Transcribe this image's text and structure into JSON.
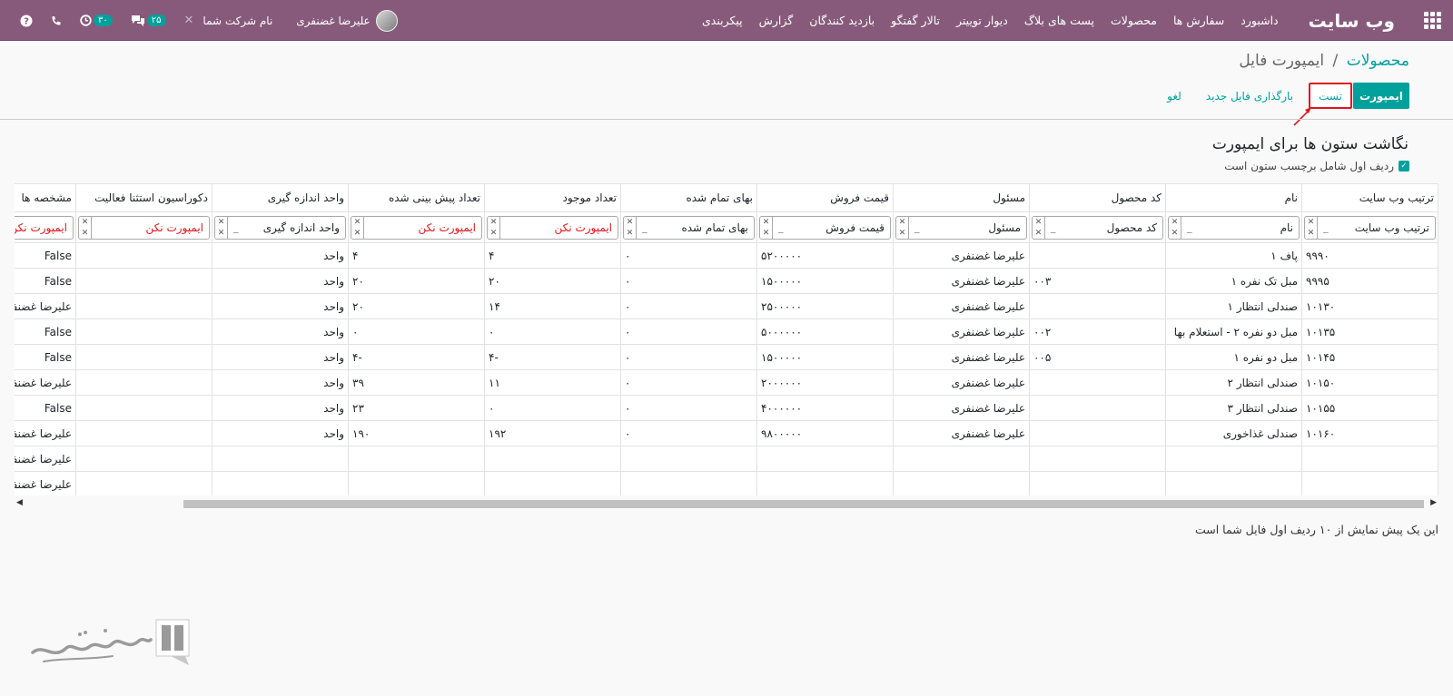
{
  "navbar": {
    "brand": "وب سایت",
    "menu": [
      "داشبورد",
      "سفارش ها",
      "محصولات",
      "پست های بلاگ",
      "دیوار توییتر",
      "تالار گفتگو",
      "بازدید کنندگان",
      "گزارش",
      "پیکربندی"
    ],
    "user_name": "علیرضا غضنفری",
    "company": "نام شرکت شما",
    "messages_count": "۲۵",
    "activities_count": "۳۰",
    "colors": {
      "navbar": "#875a7b",
      "accent": "#00a09d",
      "highlight": "#e0161e"
    }
  },
  "breadcrumb": {
    "parent": "محصولات",
    "separator": "/",
    "current": "ایمپورت فایل"
  },
  "buttons": {
    "import": "ایمپورت",
    "test": "تست",
    "reload": "بارگذاری فایل جدید",
    "cancel": "لغو"
  },
  "section": {
    "title": "نگاشت ستون ها برای ایمپورت",
    "header_checkbox_label": "ردیف اول شامل برچسب ستون است",
    "header_checkbox_checked": true
  },
  "table": {
    "columns": [
      "ترتیب وب سایت",
      "نام",
      "کد محصول",
      "مسئول",
      "قیمت فروش",
      "بهای تمام شده",
      "تعداد موجود",
      "تعداد پیش بینی شده",
      "واحد اندازه گیری",
      "دکوراسیون استثنا فعالیت",
      "مشخصه ها"
    ],
    "mappings": [
      {
        "value": "ترتیب وب سایت",
        "dash": "_",
        "red": false
      },
      {
        "value": "نام",
        "dash": "_",
        "red": false
      },
      {
        "value": "کد محصول",
        "dash": "_",
        "red": false
      },
      {
        "value": "مسئول",
        "dash": "_",
        "red": false
      },
      {
        "value": "قیمت فروش",
        "dash": "_",
        "red": false
      },
      {
        "value": "بهای تمام شده",
        "dash": "_",
        "red": false
      },
      {
        "value": "ایمپورت نکن",
        "dash": "",
        "red": true
      },
      {
        "value": "ایمپورت نکن",
        "dash": "",
        "red": true
      },
      {
        "value": "واحد اندازه گیری",
        "dash": "_",
        "red": false
      },
      {
        "value": "ایمپورت نکن",
        "dash": "",
        "red": true
      },
      {
        "value": "ایمپورت نکن",
        "dash": "",
        "red": true
      }
    ],
    "rows": [
      [
        "۹۹۹۰",
        "پاف ۱",
        "",
        "علیرضا غضنفری",
        "۵۲۰۰۰۰۰",
        "۰",
        "۴",
        "۴",
        "واحد",
        "",
        "False"
      ],
      [
        "۹۹۹۵",
        "مبل تک نفره ۱",
        "۰۰۳",
        "علیرضا غضنفری",
        "۱۵۰۰۰۰۰",
        "۰",
        "۲۰",
        "۲۰",
        "واحد",
        "",
        "False"
      ],
      [
        "۱۰۱۳۰",
        "صندلی انتظار ۱",
        "",
        "علیرضا غضنفری",
        "۲۵۰۰۰۰۰",
        "۰",
        "۱۴",
        "۲۰",
        "واحد",
        "",
        "علیرضا غضنفری"
      ],
      [
        "۱۰۱۳۵",
        "مبل دو نفره ۲ - استعلام بها",
        "۰۰۲",
        "علیرضا غضنفری",
        "۵۰۰۰۰۰۰",
        "۰",
        "۰",
        "۰",
        "واحد",
        "",
        "False"
      ],
      [
        "۱۰۱۴۵",
        "مبل دو نفره ۱",
        "۰۰۵",
        "علیرضا غضنفری",
        "۱۵۰۰۰۰۰",
        "۰",
        "-۴",
        "-۴",
        "واحد",
        "",
        "False"
      ],
      [
        "۱۰۱۵۰",
        "صندلی انتظار ۲",
        "",
        "علیرضا غضنفری",
        "۲۰۰۰۰۰۰",
        "۰",
        "۱۱",
        "۳۹",
        "واحد",
        "",
        "علیرضا غضنفری"
      ],
      [
        "۱۰۱۵۵",
        "صندلی انتظار ۳",
        "",
        "علیرضا غضنفری",
        "۴۰۰۰۰۰۰",
        "۰",
        "۰",
        "۲۳",
        "واحد",
        "",
        "False"
      ],
      [
        "۱۰۱۶۰",
        "صندلی غذاخوری",
        "",
        "علیرضا غضنفری",
        "۹۸۰۰۰۰۰",
        "۰",
        "۱۹۲",
        "۱۹۰",
        "واحد",
        "",
        "علیرضا غضنفری"
      ],
      [
        "",
        "",
        "",
        "",
        "",
        "",
        "",
        "",
        "",
        "",
        "علیرضا غضنفری"
      ],
      [
        "",
        "",
        "",
        "",
        "",
        "",
        "",
        "",
        "",
        "",
        "علیرضا غضنفری"
      ]
    ]
  },
  "preview_note": "این یک پیش نمایش از ۱۰ ردیف اول فایل شما است"
}
